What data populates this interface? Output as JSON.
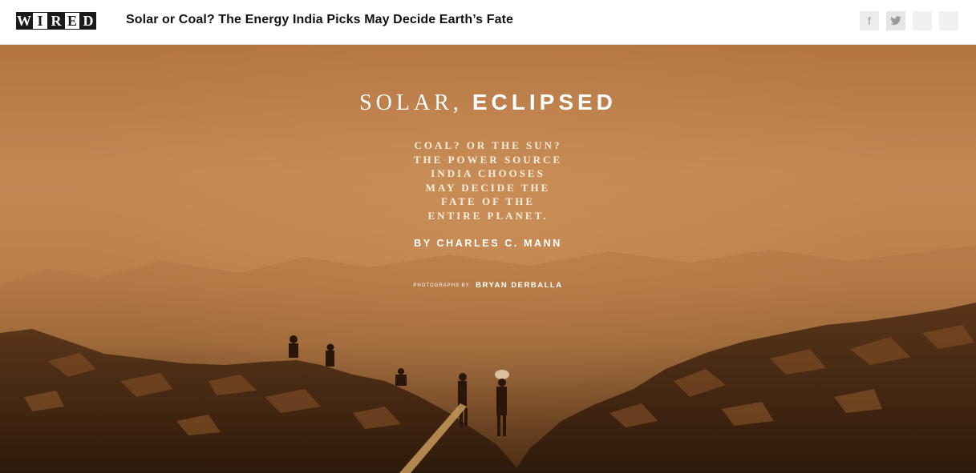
{
  "header": {
    "logo_letters": [
      "W",
      "I",
      "R",
      "E",
      "D"
    ],
    "headline": "Solar or Coal? The Energy India Picks May Decide Earth’s Fate",
    "social": {
      "facebook_glyph": "f",
      "twitter_glyph": "t",
      "icons": [
        "facebook-icon",
        "twitter-icon",
        "share-icon",
        "share-icon"
      ]
    }
  },
  "hero": {
    "title_part1": "SOLAR, ",
    "title_part2": "ECLIPSED",
    "dek_lines": [
      "COAL? OR THE SUN?",
      "THE POWER SOURCE",
      "INDIA CHOOSES",
      "MAY DECIDE THE",
      "FATE OF THE",
      "ENTIRE PLANET."
    ],
    "byline": "BY CHARLES C. MANN",
    "photo_label": "PHOTOGRAPHS BY",
    "photographer": "BRYAN DERBALLA"
  },
  "colors": {
    "sky": "#c48a55",
    "rubble_dark": "#3a2210",
    "text": "#ffffff"
  }
}
